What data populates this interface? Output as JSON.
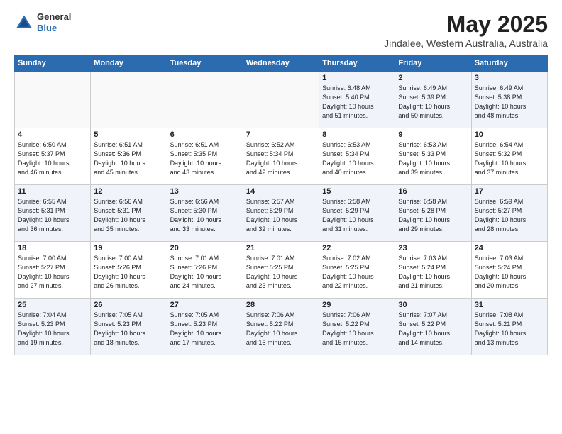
{
  "header": {
    "logo_general": "General",
    "logo_blue": "Blue",
    "title": "May 2025",
    "subtitle": "Jindalee, Western Australia, Australia"
  },
  "weekdays": [
    "Sunday",
    "Monday",
    "Tuesday",
    "Wednesday",
    "Thursday",
    "Friday",
    "Saturday"
  ],
  "rows": [
    [
      {
        "num": "",
        "content": ""
      },
      {
        "num": "",
        "content": ""
      },
      {
        "num": "",
        "content": ""
      },
      {
        "num": "",
        "content": ""
      },
      {
        "num": "1",
        "content": "Sunrise: 6:48 AM\nSunset: 5:40 PM\nDaylight: 10 hours\nand 51 minutes."
      },
      {
        "num": "2",
        "content": "Sunrise: 6:49 AM\nSunset: 5:39 PM\nDaylight: 10 hours\nand 50 minutes."
      },
      {
        "num": "3",
        "content": "Sunrise: 6:49 AM\nSunset: 5:38 PM\nDaylight: 10 hours\nand 48 minutes."
      }
    ],
    [
      {
        "num": "4",
        "content": "Sunrise: 6:50 AM\nSunset: 5:37 PM\nDaylight: 10 hours\nand 46 minutes."
      },
      {
        "num": "5",
        "content": "Sunrise: 6:51 AM\nSunset: 5:36 PM\nDaylight: 10 hours\nand 45 minutes."
      },
      {
        "num": "6",
        "content": "Sunrise: 6:51 AM\nSunset: 5:35 PM\nDaylight: 10 hours\nand 43 minutes."
      },
      {
        "num": "7",
        "content": "Sunrise: 6:52 AM\nSunset: 5:34 PM\nDaylight: 10 hours\nand 42 minutes."
      },
      {
        "num": "8",
        "content": "Sunrise: 6:53 AM\nSunset: 5:34 PM\nDaylight: 10 hours\nand 40 minutes."
      },
      {
        "num": "9",
        "content": "Sunrise: 6:53 AM\nSunset: 5:33 PM\nDaylight: 10 hours\nand 39 minutes."
      },
      {
        "num": "10",
        "content": "Sunrise: 6:54 AM\nSunset: 5:32 PM\nDaylight: 10 hours\nand 37 minutes."
      }
    ],
    [
      {
        "num": "11",
        "content": "Sunrise: 6:55 AM\nSunset: 5:31 PM\nDaylight: 10 hours\nand 36 minutes."
      },
      {
        "num": "12",
        "content": "Sunrise: 6:56 AM\nSunset: 5:31 PM\nDaylight: 10 hours\nand 35 minutes."
      },
      {
        "num": "13",
        "content": "Sunrise: 6:56 AM\nSunset: 5:30 PM\nDaylight: 10 hours\nand 33 minutes."
      },
      {
        "num": "14",
        "content": "Sunrise: 6:57 AM\nSunset: 5:29 PM\nDaylight: 10 hours\nand 32 minutes."
      },
      {
        "num": "15",
        "content": "Sunrise: 6:58 AM\nSunset: 5:29 PM\nDaylight: 10 hours\nand 31 minutes."
      },
      {
        "num": "16",
        "content": "Sunrise: 6:58 AM\nSunset: 5:28 PM\nDaylight: 10 hours\nand 29 minutes."
      },
      {
        "num": "17",
        "content": "Sunrise: 6:59 AM\nSunset: 5:27 PM\nDaylight: 10 hours\nand 28 minutes."
      }
    ],
    [
      {
        "num": "18",
        "content": "Sunrise: 7:00 AM\nSunset: 5:27 PM\nDaylight: 10 hours\nand 27 minutes."
      },
      {
        "num": "19",
        "content": "Sunrise: 7:00 AM\nSunset: 5:26 PM\nDaylight: 10 hours\nand 26 minutes."
      },
      {
        "num": "20",
        "content": "Sunrise: 7:01 AM\nSunset: 5:26 PM\nDaylight: 10 hours\nand 24 minutes."
      },
      {
        "num": "21",
        "content": "Sunrise: 7:01 AM\nSunset: 5:25 PM\nDaylight: 10 hours\nand 23 minutes."
      },
      {
        "num": "22",
        "content": "Sunrise: 7:02 AM\nSunset: 5:25 PM\nDaylight: 10 hours\nand 22 minutes."
      },
      {
        "num": "23",
        "content": "Sunrise: 7:03 AM\nSunset: 5:24 PM\nDaylight: 10 hours\nand 21 minutes."
      },
      {
        "num": "24",
        "content": "Sunrise: 7:03 AM\nSunset: 5:24 PM\nDaylight: 10 hours\nand 20 minutes."
      }
    ],
    [
      {
        "num": "25",
        "content": "Sunrise: 7:04 AM\nSunset: 5:23 PM\nDaylight: 10 hours\nand 19 minutes."
      },
      {
        "num": "26",
        "content": "Sunrise: 7:05 AM\nSunset: 5:23 PM\nDaylight: 10 hours\nand 18 minutes."
      },
      {
        "num": "27",
        "content": "Sunrise: 7:05 AM\nSunset: 5:23 PM\nDaylight: 10 hours\nand 17 minutes."
      },
      {
        "num": "28",
        "content": "Sunrise: 7:06 AM\nSunset: 5:22 PM\nDaylight: 10 hours\nand 16 minutes."
      },
      {
        "num": "29",
        "content": "Sunrise: 7:06 AM\nSunset: 5:22 PM\nDaylight: 10 hours\nand 15 minutes."
      },
      {
        "num": "30",
        "content": "Sunrise: 7:07 AM\nSunset: 5:22 PM\nDaylight: 10 hours\nand 14 minutes."
      },
      {
        "num": "31",
        "content": "Sunrise: 7:08 AM\nSunset: 5:21 PM\nDaylight: 10 hours\nand 13 minutes."
      }
    ]
  ]
}
